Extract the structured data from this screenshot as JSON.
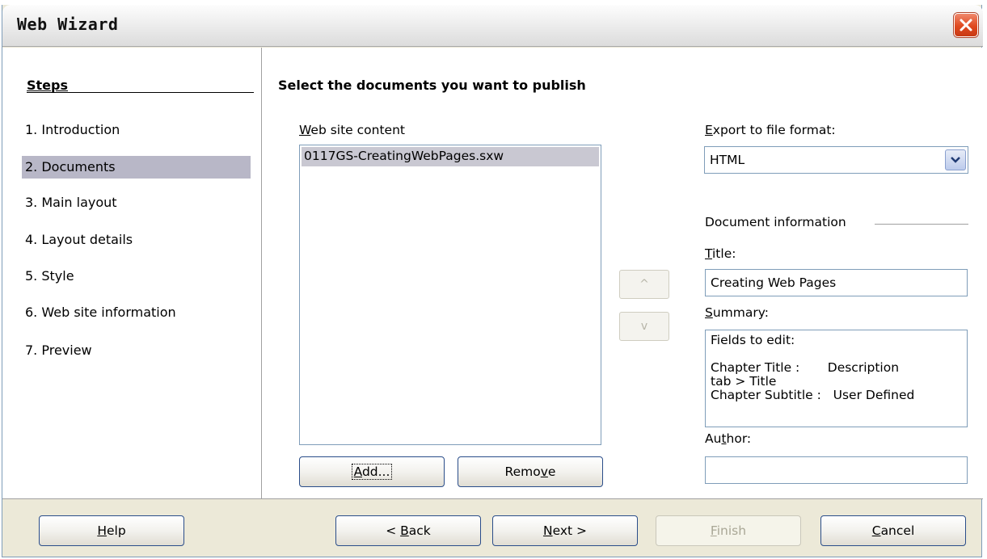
{
  "window": {
    "title": "Web Wizard"
  },
  "steps": {
    "title": "Steps",
    "items": [
      {
        "label": "1.  Introduction"
      },
      {
        "label": "2.  Documents"
      },
      {
        "label": "3.  Main layout"
      },
      {
        "label": "4.  Layout details"
      },
      {
        "label": "5.  Style"
      },
      {
        "label": "6.  Web site information"
      },
      {
        "label": "7.  Preview"
      }
    ],
    "selected_index": 1
  },
  "content": {
    "heading": "Select the documents you want to publish",
    "web_site_content": {
      "label_key": "W",
      "label_rest": "eb site content",
      "items": [
        "0117GS-CreatingWebPages.sxw"
      ]
    },
    "add_button": {
      "pre": "",
      "key": "A",
      "post": "dd..."
    },
    "remove_button": {
      "pre": "Remo",
      "key": "v",
      "post": "e"
    },
    "move_up_symbol": "^",
    "move_down_symbol": "v",
    "export_format": {
      "label_key": "E",
      "label_rest": "xport to file format:",
      "value": "HTML"
    },
    "document_information": {
      "group_label": "Document information",
      "title": {
        "label_key": "T",
        "label_rest": "itle:",
        "value": "Creating Web Pages"
      },
      "summary": {
        "label_key": "S",
        "label_rest": "ummary:",
        "lines": [
          "Fields to edit:",
          "",
          "Chapter Title :       Description",
          "tab > Title",
          "Chapter Subtitle :   User Defined"
        ]
      },
      "author": {
        "label_pre": "Au",
        "label_key": "t",
        "label_rest": "hor:",
        "value": ""
      }
    }
  },
  "footer": {
    "help": {
      "key": "H",
      "rest": "elp"
    },
    "back": {
      "pre": "< ",
      "key": "B",
      "rest": "ack"
    },
    "next": {
      "key": "N",
      "rest": "ext >"
    },
    "finish": {
      "key": "F",
      "rest": "inish"
    },
    "cancel": {
      "key": "C",
      "rest": "ancel"
    }
  },
  "colors": {
    "dialog_bg": "#ece9d8",
    "selected_step": "#b8b7c7",
    "close_button": "#e0491f",
    "button_border": "#2a4d8a"
  },
  "icons": [
    "close-icon",
    "chevron-down-icon"
  ]
}
